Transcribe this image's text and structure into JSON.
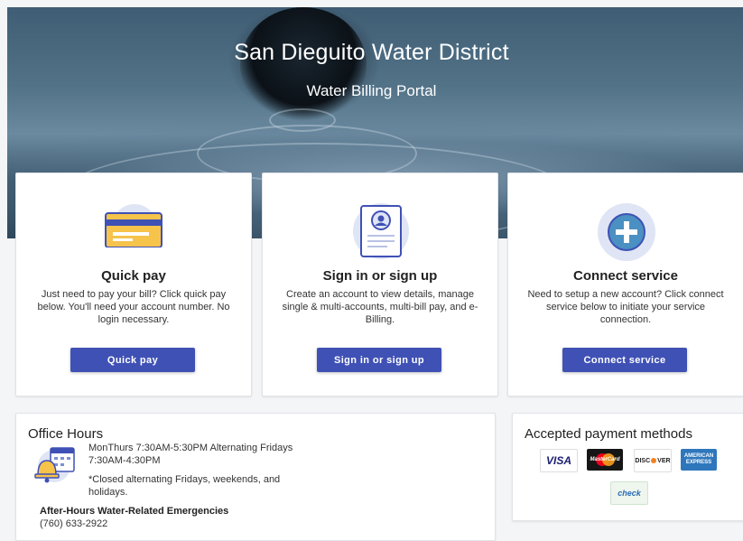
{
  "hero": {
    "title": "San Dieguito Water District",
    "subtitle": "Water Billing Portal"
  },
  "cards": [
    {
      "title": "Quick pay",
      "description": "Just need to pay your bill? Click quick pay below. You'll need your account number. No login necessary.",
      "button": "Quick pay",
      "icon": "credit-card-icon"
    },
    {
      "title": "Sign in or sign up",
      "description": "Create an account to view details, manage single & multi-accounts, multi-bill pay, and e-Billing.",
      "button": "Sign in or sign up",
      "icon": "user-document-icon"
    },
    {
      "title": "Connect service",
      "description": "Need to setup a new account? Click connect service below to initiate your service connection.",
      "button": "Connect service",
      "icon": "plus-icon"
    }
  ],
  "office": {
    "title": "Office Hours",
    "hours": "MonThurs 7:30AM-5:30PM Alternating Fridays 7:30AM-4:30PM",
    "note": "*Closed alternating Fridays, weekends, and holidays.",
    "emergency_label": "After-Hours Water-Related Emergencies",
    "emergency_phone": "(760) 633-2922",
    "icon": "bell-calendar-icon"
  },
  "payment": {
    "title": "Accepted payment methods",
    "visa": "VISA",
    "mastercard": "MasterCard",
    "discover_a": "DISC",
    "discover_b": "VER",
    "amex": "AMERICAN EXPRESS",
    "echeck": "check"
  },
  "colors": {
    "primary": "#3f51b5",
    "icon_bg": "#dfe5f5"
  }
}
